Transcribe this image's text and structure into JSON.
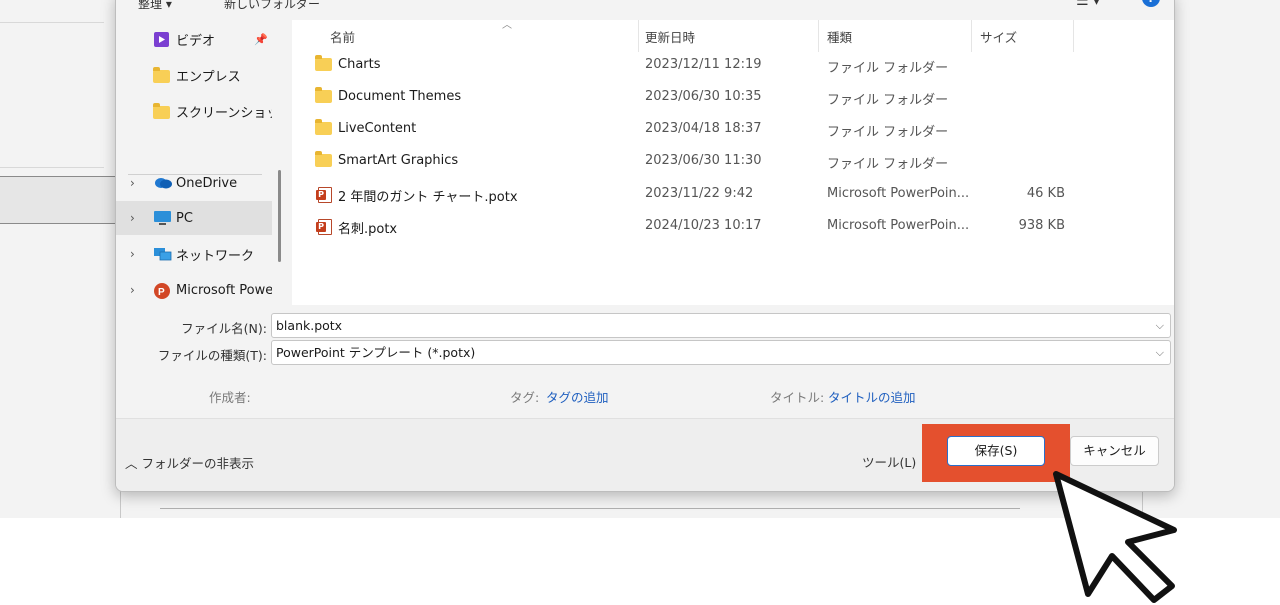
{
  "toolbar": {
    "organize_label": "整理 ▾",
    "new_folder_label": "新しいフォルダー",
    "view_icon": "view-options-icon",
    "help_icon": "help-icon"
  },
  "nav": {
    "items": [
      {
        "label": "ビデオ",
        "icon": "video-icon",
        "pinned": true
      },
      {
        "label": "エンプレス",
        "icon": "folder-icon"
      },
      {
        "label": "スクリーンショット",
        "icon": "folder-icon"
      },
      {
        "label": "OneDrive",
        "icon": "cloud-icon"
      },
      {
        "label": "PC",
        "icon": "computer-icon",
        "selected": true
      },
      {
        "label": "ネットワーク",
        "icon": "network-icon"
      },
      {
        "label": "Microsoft Power",
        "icon": "powerpoint-icon"
      }
    ]
  },
  "columns": {
    "name": "名前",
    "date": "更新日時",
    "type": "種類",
    "size": "サイズ"
  },
  "files": [
    {
      "name": "Charts",
      "date": "2023/12/11 12:19",
      "type": "ファイル フォルダー",
      "size": "",
      "icon": "folder-icon"
    },
    {
      "name": "Document Themes",
      "date": "2023/06/30 10:35",
      "type": "ファイル フォルダー",
      "size": "",
      "icon": "folder-icon"
    },
    {
      "name": "LiveContent",
      "date": "2023/04/18 18:37",
      "type": "ファイル フォルダー",
      "size": "",
      "icon": "folder-icon"
    },
    {
      "name": "SmartArt Graphics",
      "date": "2023/06/30 11:30",
      "type": "ファイル フォルダー",
      "size": "",
      "icon": "folder-icon"
    },
    {
      "name": "2 年間のガント チャート.potx",
      "date": "2023/11/22 9:42",
      "type": "Microsoft PowerPoin...",
      "size": "46 KB",
      "icon": "powerpoint-file-icon"
    },
    {
      "name": "名刺.potx",
      "date": "2024/10/23 10:17",
      "type": "Microsoft PowerPoin...",
      "size": "938 KB",
      "icon": "powerpoint-file-icon"
    }
  ],
  "form": {
    "filename_label": "ファイル名(N):",
    "filename_value": "blank.potx",
    "filetype_label": "ファイルの種類(T):",
    "filetype_value": "PowerPoint テンプレート (*.potx)",
    "author_label": "作成者:",
    "tags_label": "タグ:",
    "tags_value": "タグの追加",
    "title_label": "タイトル:",
    "title_value": "タイトルの追加"
  },
  "footer": {
    "hide_folders_label": "フォルダーの非表示",
    "tools_label": "ツール(L)",
    "save_label": "保存(S)",
    "cancel_label": "キャンセル"
  },
  "colors": {
    "highlight": "#e4502e",
    "link": "#1f5fbf",
    "save_border": "#2a6fca"
  }
}
